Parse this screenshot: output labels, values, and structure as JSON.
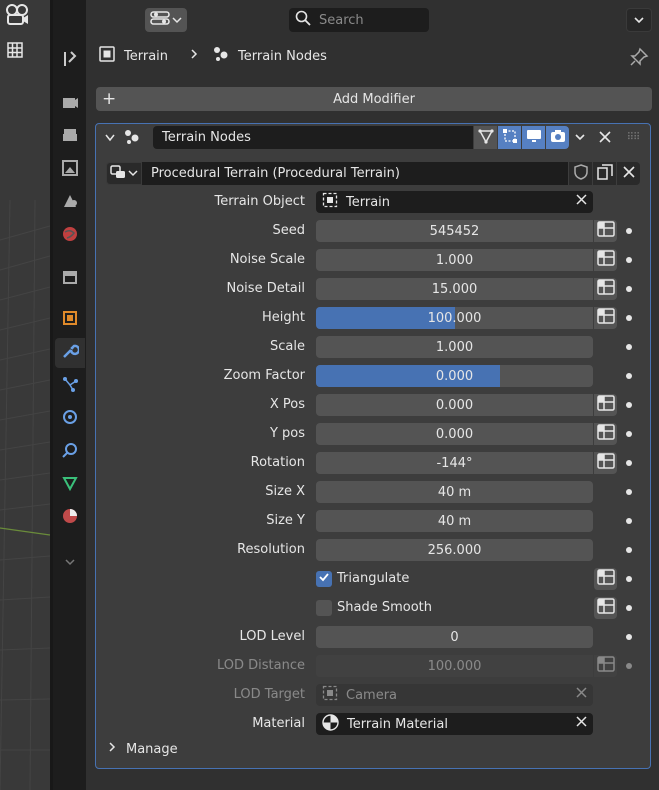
{
  "search": {
    "placeholder": "Search"
  },
  "breadcrumb": {
    "object": "Terrain",
    "modifier": "Terrain Nodes"
  },
  "add_modifier_label": "Add Modifier",
  "modifier": {
    "name": "Terrain Nodes"
  },
  "node_group": {
    "name": "Procedural Terrain (Procedural Terrain)"
  },
  "props": {
    "terrain_object": {
      "label": "Terrain Object",
      "value": "Terrain"
    },
    "seed": {
      "label": "Seed",
      "value": "545452"
    },
    "noise_scale": {
      "label": "Noise Scale",
      "value": "1.000"
    },
    "noise_detail": {
      "label": "Noise Detail",
      "value": "15.000"
    },
    "height": {
      "label": "Height",
      "value": "100.000",
      "fill": 0.5
    },
    "scale": {
      "label": "Scale",
      "value": "1.000"
    },
    "zoom_factor": {
      "label": "Zoom Factor",
      "value": "0.000",
      "fill": 0.666
    },
    "x_pos": {
      "label": "X Pos",
      "value": "0.000"
    },
    "y_pos": {
      "label": "Y pos",
      "value": "0.000"
    },
    "rotation": {
      "label": "Rotation",
      "value": "-144°"
    },
    "size_x": {
      "label": "Size X",
      "value": "40 m"
    },
    "size_y": {
      "label": "Size Y",
      "value": "40 m"
    },
    "resolution": {
      "label": "Resolution",
      "value": "256.000"
    },
    "triangulate": {
      "label": "Triangulate",
      "checked": true
    },
    "shade_smooth": {
      "label": "Shade Smooth",
      "checked": false
    },
    "lod_level": {
      "label": "LOD Level",
      "value": "0"
    },
    "lod_distance": {
      "label": "LOD Distance",
      "value": "100.000"
    },
    "lod_target": {
      "label": "LOD Target",
      "value": "Camera"
    },
    "material": {
      "label": "Material",
      "value": "Terrain Material"
    }
  },
  "manage_label": "Manage",
  "colors": {
    "accent": "#4772b3",
    "panel_border": "#4772b3",
    "toggle_on": "#5680c2"
  }
}
